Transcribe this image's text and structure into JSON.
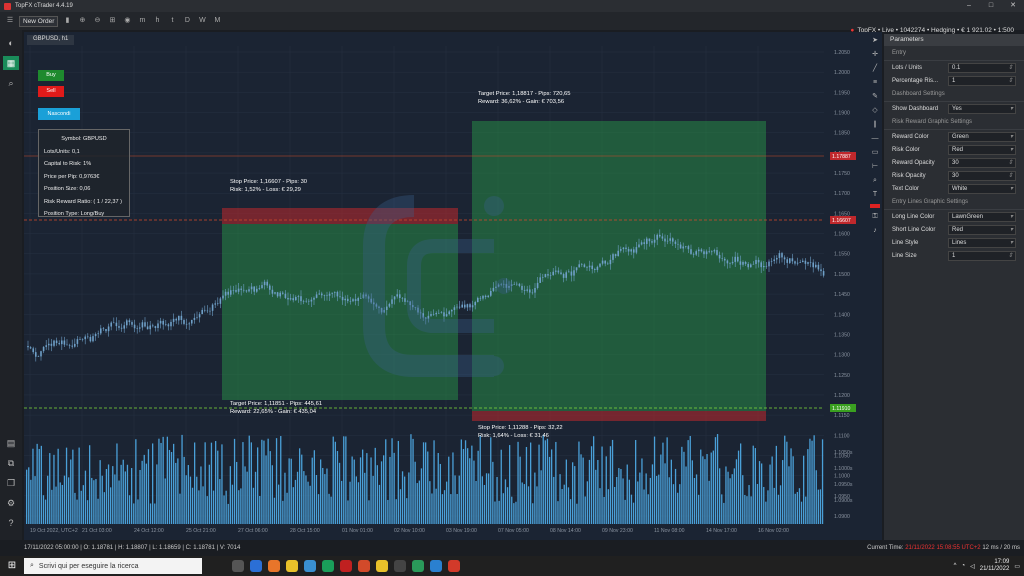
{
  "window": {
    "title": "TopFX cTrader 4.4.19",
    "controls": [
      "–",
      "□",
      "✕"
    ]
  },
  "toolbar": {
    "new_order": "New Order",
    "timeframes": [
      "m",
      "h",
      "t",
      "D",
      "W",
      "M"
    ]
  },
  "account": {
    "broker": "TopFX",
    "mode": "Live",
    "id": "1042274",
    "type": "Hedging",
    "balance": "€ 1 921.02",
    "leverage": "1:500",
    "full": "TopFX • Live • 1042274 • Hedging • € 1 921.02 • 1:500"
  },
  "chart": {
    "tab": "GBPUSD, h1",
    "price_labels": [
      "1.2050",
      "1.2000",
      "1.1950",
      "1.1900",
      "1.1850",
      "1.1800",
      "1.1750",
      "1.1700",
      "1.1650",
      "1.1600",
      "1.1550",
      "1.1500",
      "1.1450",
      "1.1400",
      "1.1350",
      "1.1300",
      "1.1250",
      "1.1200",
      "1.1150",
      "1.1100",
      "1.1050",
      "1.1000",
      "1.0950",
      "1.0900"
    ],
    "current_price": "1.17887",
    "stop_price_tag": "1.16607",
    "target_price_tag": "1.11910",
    "volume_labels": [
      "1.1050s",
      "1.1000s",
      "1.0950s",
      "1.0900s"
    ],
    "dates": [
      "19 Oct 2022, UTC+2",
      "21 Oct 03:00",
      "24 Oct 12:00",
      "25 Oct 21:00",
      "27 Oct 06:00",
      "28 Oct 15:00",
      "01 Nov 01:00",
      "02 Nov 10:00",
      "03 Nov 19:00",
      "07 Nov 05:00",
      "08 Nov 14:00",
      "09 Nov 23:00",
      "11 Nov 08:00",
      "14 Nov 17:00",
      "16 Nov 02:00"
    ],
    "date_highlight": "14 Nov"
  },
  "buttons": {
    "buy": "Buy",
    "sell": "Sell",
    "hide": "Nascondi"
  },
  "dashboard": {
    "symbol": "Symbol: GBPUSD",
    "lots": "Lots/Units:  0,1",
    "capital": "Capital to Risk:  1%",
    "price_pip": "Price per Pip:  0,9763€",
    "position_size": "Position Size:  0,06",
    "rr_ratio": "Risk Reward Ratio: ( 1 / 22,37 )",
    "position_type": "Position Type: Long/Buy"
  },
  "annotations": {
    "stop_a_1": "Stop Price: 1,16607 - Pips: 30",
    "stop_a_2": "Risk: 1,52% - Loss: € 29,29",
    "target_a_1": "Target Price: 1,11851 - Pips: 445,61",
    "target_a_2": "Reward: 22,65% - Gain: € 435,04",
    "target_b_1": "Target Price: 1,18817 - Pips: 720,65",
    "target_b_2": "Reward: 36,62% - Gain: € 703,56",
    "stop_b_1": "Stop Price: 1,11288 - Pips: 32,22",
    "stop_b_2": "Risk: 1,64% - Loss: € 31,46"
  },
  "parameters": {
    "title": "Parameters",
    "entry": {
      "section": "Entry",
      "lots_label": "Lots / Units",
      "lots": "0.1",
      "pct_label": "Percentage Ris...",
      "pct": "1"
    },
    "dash": {
      "section": "Dashboard Settings",
      "show_label": "Show Dashboard",
      "show": "Yes"
    },
    "rr": {
      "section": "Risk Reward Graphic Settings",
      "reward_color_label": "Reward Color",
      "reward_color": "Green",
      "risk_color_label": "Risk Color",
      "risk_color": "Red",
      "reward_opacity_label": "Reward Opacity",
      "reward_opacity": "30",
      "risk_opacity_label": "Risk Opacity",
      "risk_opacity": "30",
      "text_color_label": "Text Color",
      "text_color": "White"
    },
    "lines": {
      "section": "Entry Lines Graphic Settings",
      "long_label": "Long Line Color",
      "long": "LawnGreen",
      "short_label": "Short Line Color",
      "short": "Red",
      "style_label": "Line Style",
      "style": "Lines",
      "size_label": "Line Size",
      "size": "1"
    }
  },
  "status": {
    "ohlc": "17/11/2022 05:00:00 | O: 1.18781 | H: 1.18807 | L: 1.18659 | C: 1.18781 | V: 7014",
    "current_time_label": "Current Time:",
    "current_time": "21/11/2022 15:08:55",
    "tz": "UTC+2",
    "latency": "12 ms / 20 ms"
  },
  "taskbar": {
    "search": "Scrivi qui per eseguire la ricerca",
    "time": "17:09",
    "date": "21/11/2022"
  },
  "colors": {
    "green": "#2aa04a",
    "red": "#c0282c",
    "blue": "#1aa0d8",
    "candle": "#6fa0c8",
    "volume": "#4aa0d8"
  }
}
